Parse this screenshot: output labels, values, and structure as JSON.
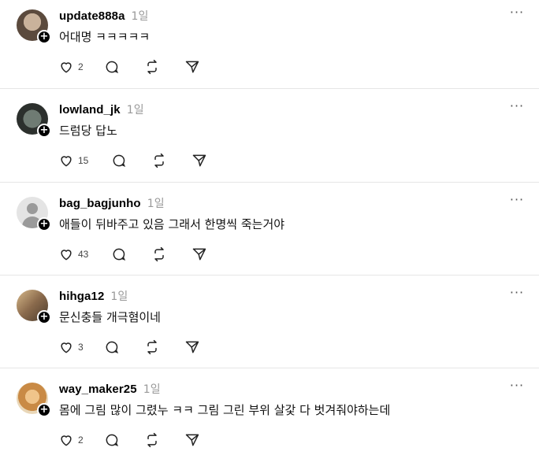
{
  "posts": [
    {
      "username": "update888a",
      "time": "1일",
      "text": "어대명 ㅋㅋㅋㅋㅋ",
      "likes": "2"
    },
    {
      "username": "lowland_jk",
      "time": "1일",
      "text": "드럼당 답노",
      "likes": "15"
    },
    {
      "username": "bag_bagjunho",
      "time": "1일",
      "text": "애들이 뒤바주고 있음 그래서 한명씩 죽는거야",
      "likes": "43"
    },
    {
      "username": "hihga12",
      "time": "1일",
      "text": "문신충들 개극혐이네",
      "likes": "3"
    },
    {
      "username": "way_maker25",
      "time": "1일",
      "text": "몸에 그림 많이 그렸누 ㅋㅋ 그림 그린 부위 살갗 다 벗겨줘야하는데",
      "likes": "2"
    }
  ],
  "icons": {
    "like": "heart-icon",
    "reply": "comment-icon",
    "repost": "repost-icon",
    "share": "send-icon",
    "more": "more-options-icon",
    "follow": "plus-icon"
  },
  "colors": {
    "divider": "#e6e6e6",
    "muted": "#999999",
    "text": "#111111"
  }
}
